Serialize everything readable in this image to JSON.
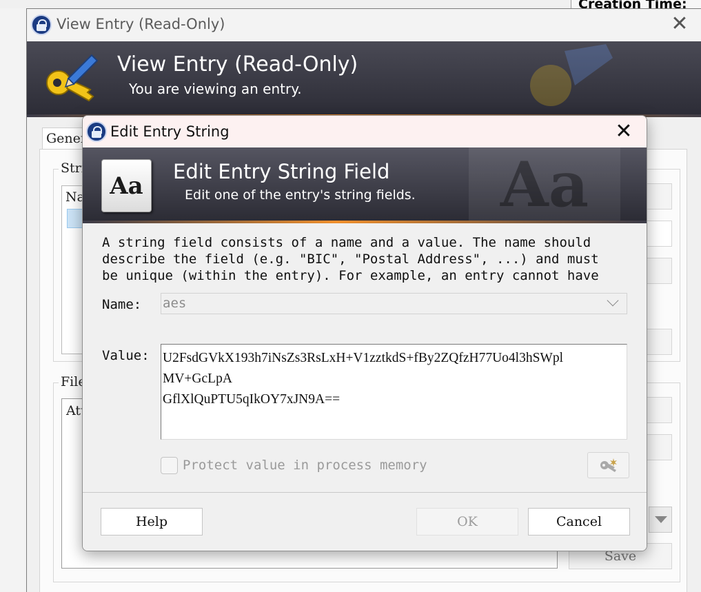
{
  "background": {
    "creation_time_label": "Creation Time:"
  },
  "view_entry": {
    "window_title": "View Entry (Read-Only)",
    "banner_title": "View Entry (Read-Only)",
    "banner_subtitle": "You are viewing an entry.",
    "tab_general": "General",
    "group_strings": "Strings",
    "strings_list_header": "Name",
    "group_files": "File attachments",
    "files_list_header": "Attachments",
    "save_button": "Save"
  },
  "dialog": {
    "title": "Edit Entry String",
    "banner_title": "Edit Entry String Field",
    "banner_subtitle": "Edit one of the entry's string fields.",
    "description": "A string field consists of a name and a value. The name should\ndescribe the field (e.g. \"BIC\", \"Postal Address\", ...) and must\nbe unique (within the entry). For example, an entry cannot have",
    "name_label": "Name:",
    "name_value": "aes",
    "value_label": "Value:",
    "value_text": "U2FsdGVkX193h7iNsZs3RsLxH+V1zztkdS+fBy2ZQfzH77Uo4l3hSWpl\nMV+GcLpA\nGflXlQuPTU5qIkOY7xJN9A==",
    "protect_label": "Protect value in process memory",
    "protect_checked": false,
    "help_button": "Help",
    "ok_button": "OK",
    "cancel_button": "Cancel",
    "close_glyph": "✕"
  },
  "colors": {
    "banner_dark": "#2c2c36",
    "banner_accent": "#f0902d",
    "dialog_titlebar": "#fdf1f1"
  },
  "icons": [
    "app-lock-icon",
    "key-pencil-icon",
    "text-aa-icon",
    "password-generator-icon",
    "chevron-down-icon",
    "close-icon"
  ]
}
